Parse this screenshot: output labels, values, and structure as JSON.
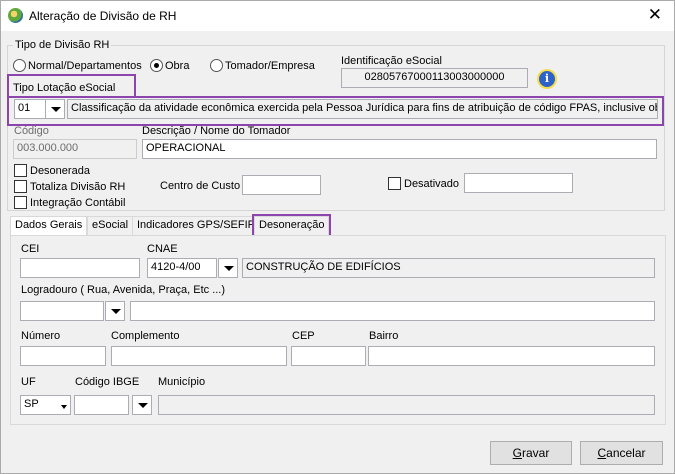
{
  "window": {
    "title": "Alteração de Divisão de RH",
    "close_icon": "close-icon"
  },
  "tipo_divisao": {
    "group_label": "Tipo de Divisão RH",
    "options": [
      "Normal/Departamentos",
      "Obra",
      "Tomador/Empresa"
    ],
    "selected": "Obra"
  },
  "identificacao": {
    "label": "Identificação eSocial",
    "value": "02805767000113003000000"
  },
  "tipo_lotacao": {
    "label": "Tipo Lotação eSocial",
    "code": "01",
    "description": "Classificação da atividade econômica exercida pela Pessoa Jurídica para fins de atribuição de código FPAS, inclusive obras"
  },
  "codigo": {
    "label": "Código",
    "value": "003.000.000"
  },
  "descricao": {
    "label": "Descrição / Nome do Tomador",
    "value": "OPERACIONAL"
  },
  "checks": {
    "desonerada": "Desonerada",
    "totaliza": "Totaliza Divisão RH",
    "integracao": "Integração Contábil",
    "desativado": "Desativado"
  },
  "centro_custo": {
    "label": "Centro de Custo",
    "value": ""
  },
  "desativado_field": {
    "value": ""
  },
  "tabs": [
    "Dados Gerais",
    "eSocial",
    "Indicadores GPS/SEFIP",
    "Desoneração"
  ],
  "form": {
    "cei_label": "CEI",
    "cei_value": "",
    "cnae_label": "CNAE",
    "cnae_code": "4120-4/00",
    "cnae_desc": "CONSTRUÇÃO DE EDIFÍCIOS",
    "logradouro_label": "Logradouro ( Rua, Avenida, Praça, Etc ...)",
    "logradouro_tipo": "",
    "logradouro_value": "",
    "numero_label": "Número",
    "numero_value": "",
    "complemento_label": "Complemento",
    "complemento_value": "",
    "cep_label": "CEP",
    "cep_value": "",
    "bairro_label": "Bairro",
    "bairro_value": "",
    "uf_label": "UF",
    "uf_value": "SP",
    "ibge_label": "Código IBGE",
    "ibge_value": "",
    "municipio_label": "Município",
    "municipio_value": ""
  },
  "buttons": {
    "gravar_rest": "ravar",
    "gravar_u": "G",
    "cancelar_u": "C",
    "cancelar_rest": "ancelar"
  },
  "colors": {
    "highlight": "#8e44ad"
  }
}
